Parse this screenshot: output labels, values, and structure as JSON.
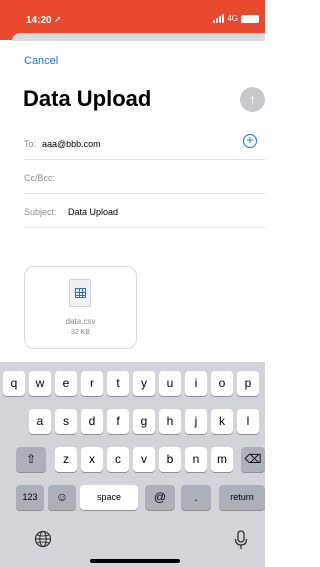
{
  "status": {
    "time": "14:20",
    "network": "4G"
  },
  "compose": {
    "cancel_label": "Cancel",
    "title": "Data Upload",
    "to_label": "To:",
    "to_value": "aaa@bbb.com",
    "cc_label": "Cc/Bcc:",
    "subject_label": "Subject:",
    "subject_value": "Data Upload"
  },
  "attachment": {
    "name": "data.csv",
    "size": "32 KB"
  },
  "keyboard": {
    "row1": [
      "q",
      "w",
      "e",
      "r",
      "t",
      "y",
      "u",
      "i",
      "o",
      "p"
    ],
    "row2": [
      "a",
      "s",
      "d",
      "f",
      "g",
      "h",
      "j",
      "k",
      "l"
    ],
    "row3": [
      "z",
      "x",
      "c",
      "v",
      "b",
      "n",
      "m"
    ],
    "number_key": "123",
    "emoji_key": "☺",
    "space_key": "space",
    "at_key": "@",
    "dot_key": ".",
    "return_key": "return",
    "shift_glyph": "⇧",
    "delete_glyph": "⌫"
  },
  "colors": {
    "status_bar": "#e8492f",
    "accent": "#1a6fe0"
  }
}
